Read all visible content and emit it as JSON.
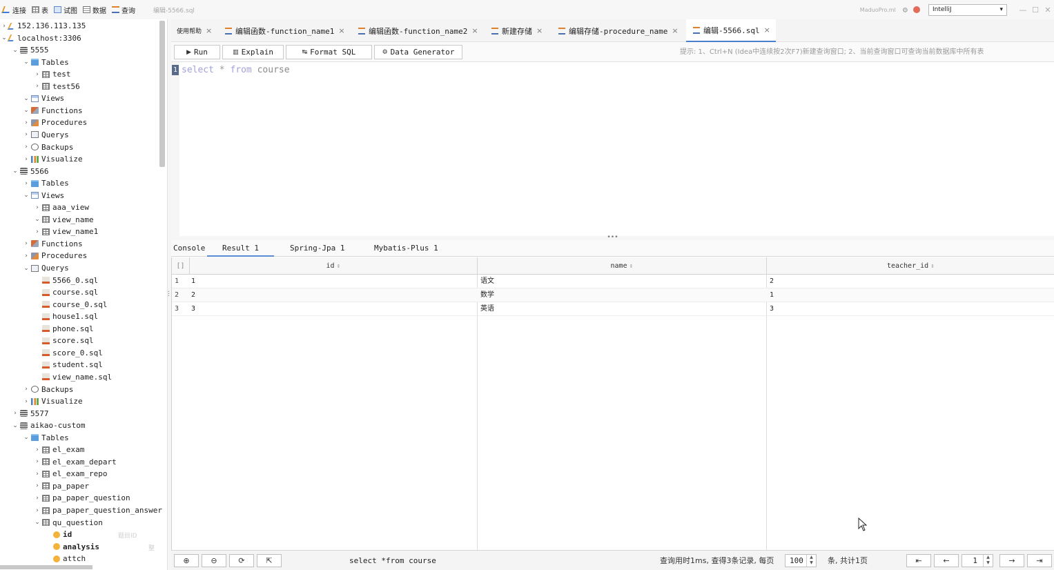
{
  "toolbar": {
    "buttons": [
      {
        "label": "连接",
        "icon": "connection-icon"
      },
      {
        "label": "表",
        "icon": "table-icon"
      },
      {
        "label": "试图",
        "icon": "view-icon"
      },
      {
        "label": "数据",
        "icon": "data-icon"
      },
      {
        "label": "查询",
        "icon": "query-icon"
      }
    ],
    "current_file": "编辑-5566.sql",
    "brand": "MaduoPro.ml",
    "theme_select": "IntelliJ"
  },
  "tree": [
    {
      "depth": 0,
      "chevron": "›",
      "icon": "server",
      "label": "152.136.113.135"
    },
    {
      "depth": 0,
      "chevron": "⌄",
      "icon": "server",
      "label": "localhost:3306"
    },
    {
      "depth": 1,
      "chevron": "⌄",
      "icon": "db",
      "label": "5555"
    },
    {
      "depth": 2,
      "chevron": "⌄",
      "icon": "folder",
      "label": "Tables"
    },
    {
      "depth": 3,
      "chevron": "›",
      "icon": "table",
      "label": "test"
    },
    {
      "depth": 3,
      "chevron": "›",
      "icon": "table",
      "label": "test56"
    },
    {
      "depth": 2,
      "chevron": "⌄",
      "icon": "views",
      "label": "Views"
    },
    {
      "depth": 2,
      "chevron": "⌄",
      "icon": "func",
      "label": "Functions"
    },
    {
      "depth": 2,
      "chevron": "›",
      "icon": "proc",
      "label": "Procedures"
    },
    {
      "depth": 2,
      "chevron": "›",
      "icon": "query",
      "label": "Querys"
    },
    {
      "depth": 2,
      "chevron": "›",
      "icon": "backup",
      "label": "Backups"
    },
    {
      "depth": 2,
      "chevron": "›",
      "icon": "visual",
      "label": "Visualize"
    },
    {
      "depth": 1,
      "chevron": "⌄",
      "icon": "db",
      "label": "5566"
    },
    {
      "depth": 2,
      "chevron": "›",
      "icon": "folder",
      "label": "Tables"
    },
    {
      "depth": 2,
      "chevron": "⌄",
      "icon": "views",
      "label": "Views"
    },
    {
      "depth": 3,
      "chevron": "›",
      "icon": "table",
      "label": "aaa_view"
    },
    {
      "depth": 3,
      "chevron": "⌄",
      "icon": "table",
      "label": "view_name"
    },
    {
      "depth": 3,
      "chevron": "›",
      "icon": "table",
      "label": "view_name1"
    },
    {
      "depth": 2,
      "chevron": "›",
      "icon": "func",
      "label": "Functions"
    },
    {
      "depth": 2,
      "chevron": "›",
      "icon": "proc",
      "label": "Procedures"
    },
    {
      "depth": 2,
      "chevron": "⌄",
      "icon": "query",
      "label": "Querys"
    },
    {
      "depth": 3,
      "chevron": "",
      "icon": "sql",
      "label": "5566_0.sql"
    },
    {
      "depth": 3,
      "chevron": "",
      "icon": "sql",
      "label": "course.sql"
    },
    {
      "depth": 3,
      "chevron": "",
      "icon": "sql",
      "label": "course_0.sql"
    },
    {
      "depth": 3,
      "chevron": "",
      "icon": "sql",
      "label": "house1.sql"
    },
    {
      "depth": 3,
      "chevron": "",
      "icon": "sql",
      "label": "phone.sql"
    },
    {
      "depth": 3,
      "chevron": "",
      "icon": "sql",
      "label": "score.sql"
    },
    {
      "depth": 3,
      "chevron": "",
      "icon": "sql",
      "label": "score_0.sql"
    },
    {
      "depth": 3,
      "chevron": "",
      "icon": "sql",
      "label": "student.sql"
    },
    {
      "depth": 3,
      "chevron": "",
      "icon": "sql",
      "label": "view_name.sql"
    },
    {
      "depth": 2,
      "chevron": "›",
      "icon": "backup",
      "label": "Backups"
    },
    {
      "depth": 2,
      "chevron": "›",
      "icon": "visual",
      "label": "Visualize"
    },
    {
      "depth": 1,
      "chevron": "›",
      "icon": "db",
      "label": "5577"
    },
    {
      "depth": 1,
      "chevron": "⌄",
      "icon": "db",
      "label": "aikao-custom"
    },
    {
      "depth": 2,
      "chevron": "⌄",
      "icon": "folder",
      "label": "Tables"
    },
    {
      "depth": 3,
      "chevron": "›",
      "icon": "table",
      "label": "el_exam"
    },
    {
      "depth": 3,
      "chevron": "›",
      "icon": "table",
      "label": "el_exam_depart"
    },
    {
      "depth": 3,
      "chevron": "›",
      "icon": "table",
      "label": "el_exam_repo"
    },
    {
      "depth": 3,
      "chevron": "›",
      "icon": "table",
      "label": "pa_paper"
    },
    {
      "depth": 3,
      "chevron": "›",
      "icon": "table",
      "label": "pa_paper_question"
    },
    {
      "depth": 3,
      "chevron": "›",
      "icon": "table",
      "label": "pa_paper_question_answer"
    },
    {
      "depth": 3,
      "chevron": "⌄",
      "icon": "table",
      "label": "qu_question"
    },
    {
      "depth": 4,
      "chevron": "",
      "icon": "field",
      "label": "id",
      "bold": true,
      "hint": "题目ID"
    },
    {
      "depth": 4,
      "chevron": "",
      "icon": "field",
      "label": "analysis",
      "bold": true,
      "hint": "整"
    },
    {
      "depth": 4,
      "chevron": "",
      "icon": "field",
      "label": "attch"
    }
  ],
  "tabs": [
    {
      "label": "使用帮助",
      "close": "×"
    },
    {
      "label": "编辑函数-function_name1",
      "close": "×"
    },
    {
      "label": "编辑函数-function_name2",
      "close": "×"
    },
    {
      "label": "新建存储",
      "close": "×"
    },
    {
      "label": "编辑存储-procedure_name",
      "close": "×"
    },
    {
      "label": "编辑-5566.sql",
      "close": "×",
      "active": true
    }
  ],
  "editor_toolbar": {
    "run": "Run",
    "explain": "Explain",
    "format": "Format SQL",
    "generator": "Data Generator",
    "tip": "提示: 1、Ctrl+N (Idea中连续按2次F7)新建查询窗口; 2、当前查询窗口可查询当前数据库中所有表"
  },
  "editor": {
    "line_number": "1",
    "kw_select": "select",
    "op_star": "*",
    "kw_from": "from",
    "ident": "course"
  },
  "result_tabs": [
    "Console",
    "Result 1",
    "Spring-Jpa 1",
    "Mybatis-Plus 1"
  ],
  "grid": {
    "corner": "[]",
    "columns": [
      "id",
      "name",
      "teacher_id"
    ],
    "sort_icon": "⇕",
    "rows": [
      {
        "num": "1",
        "id": "1",
        "name": "语文",
        "teacher_id": "2"
      },
      {
        "num": "2",
        "id": "2",
        "name": "数学",
        "teacher_id": "1"
      },
      {
        "num": "3",
        "id": "3",
        "name": "英语",
        "teacher_id": "3"
      }
    ]
  },
  "bottom": {
    "add": "⊕",
    "remove": "⊖",
    "refresh": "⟳",
    "export": "⇱",
    "sql": "select *from course",
    "stat_prefix": "查询用时1ms, 查得3条记录, 每页",
    "page_size": "100",
    "stat_suffix": "条, 共计1页",
    "first": "⇤",
    "prev": "←",
    "page": "1",
    "next": "→",
    "last": "⇥"
  }
}
